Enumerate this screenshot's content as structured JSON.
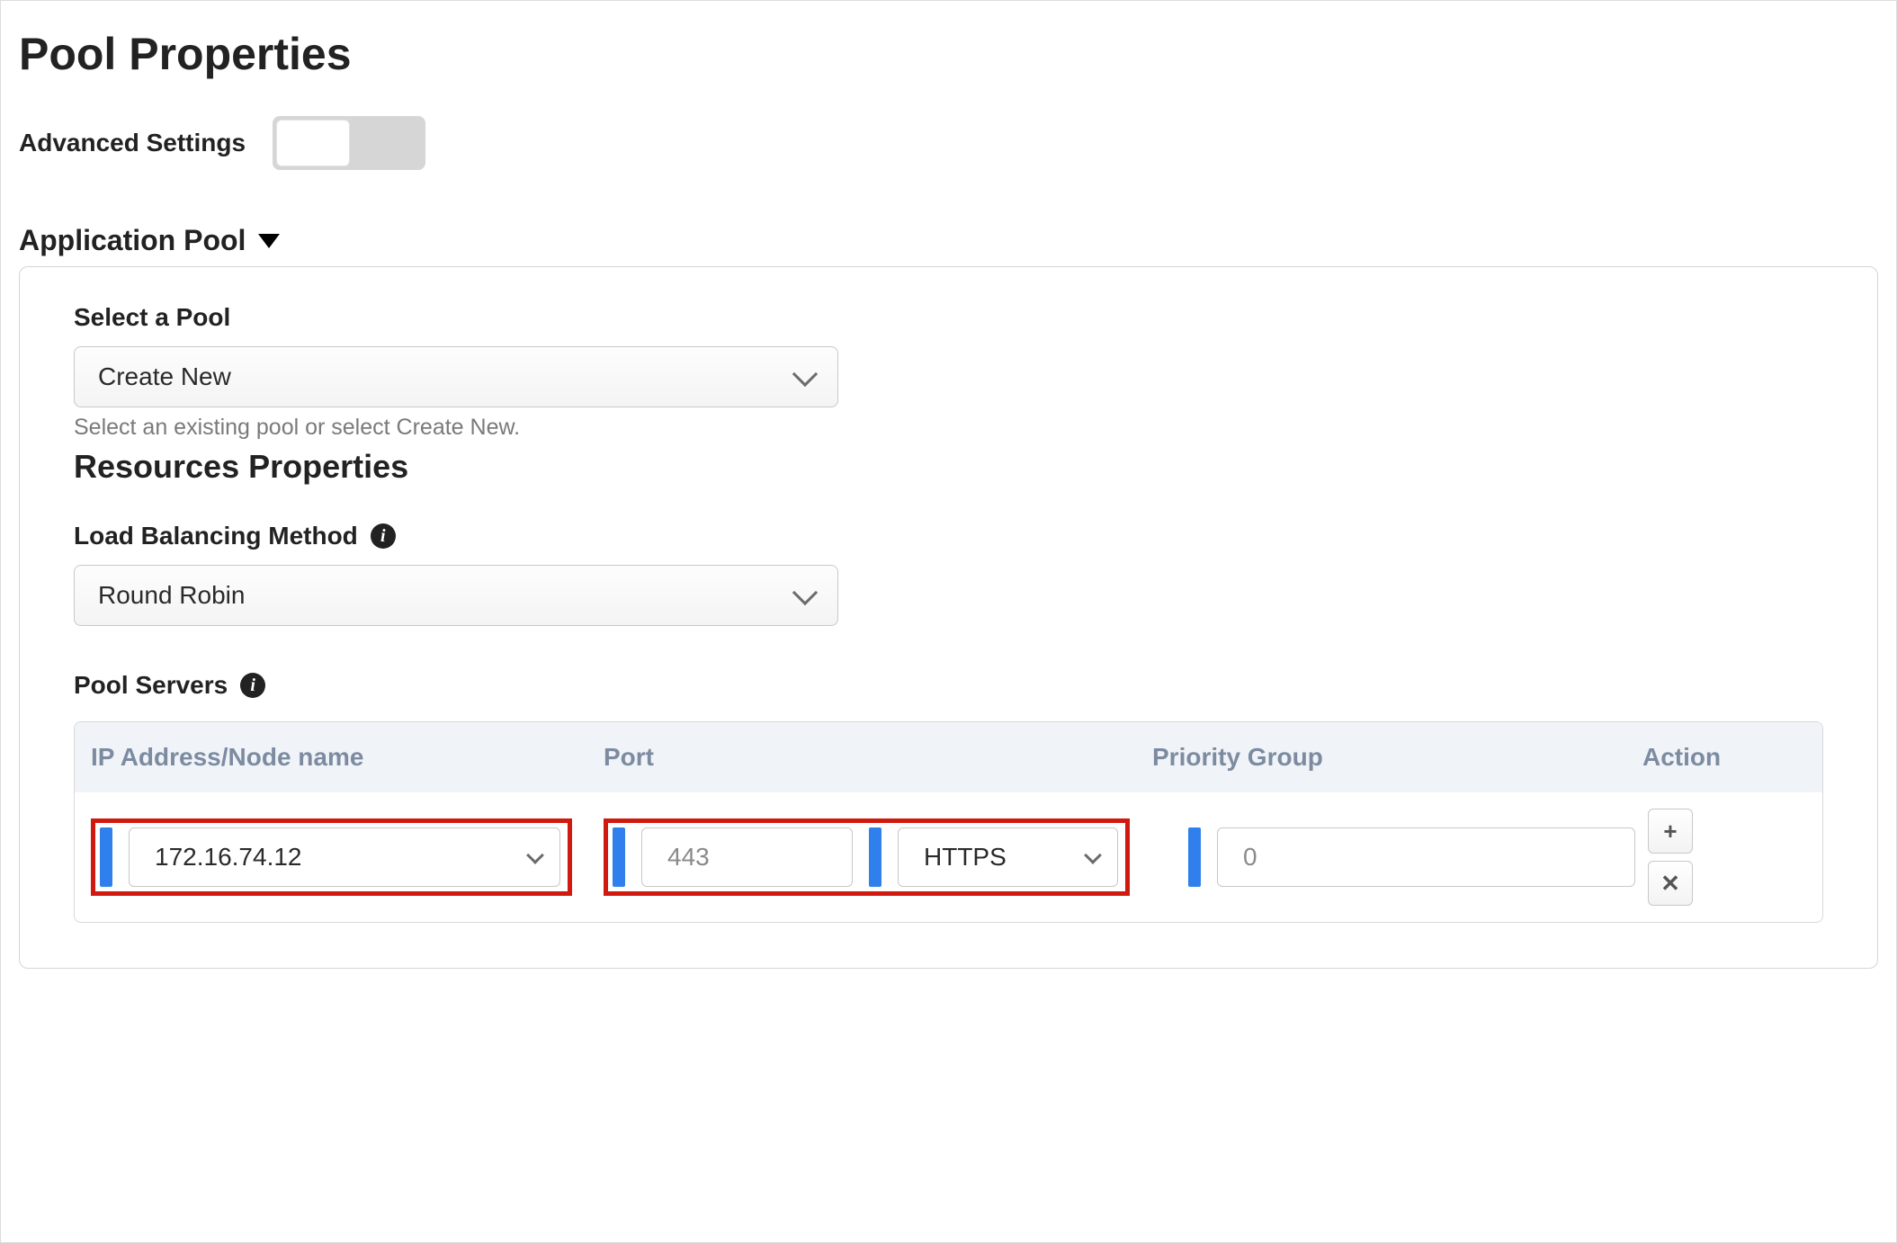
{
  "page": {
    "title": "Pool Properties"
  },
  "advanced": {
    "label": "Advanced Settings",
    "enabled": false
  },
  "application_pool": {
    "header": "Application Pool",
    "select_pool": {
      "label": "Select a Pool",
      "value": "Create New",
      "help": "Select an existing pool or select Create New."
    },
    "resources_heading": "Resources Properties",
    "lb_method": {
      "label": "Load Balancing Method",
      "value": "Round Robin"
    },
    "pool_servers": {
      "label": "Pool Servers",
      "columns": {
        "ip": "IP Address/Node name",
        "port": "Port",
        "priority": "Priority Group",
        "action": "Action"
      },
      "rows": [
        {
          "ip": "172.16.74.12",
          "port": "443",
          "protocol": "HTTPS",
          "priority": "0"
        }
      ]
    },
    "icons": {
      "info": "i",
      "plus": "+",
      "close": "✕"
    }
  }
}
